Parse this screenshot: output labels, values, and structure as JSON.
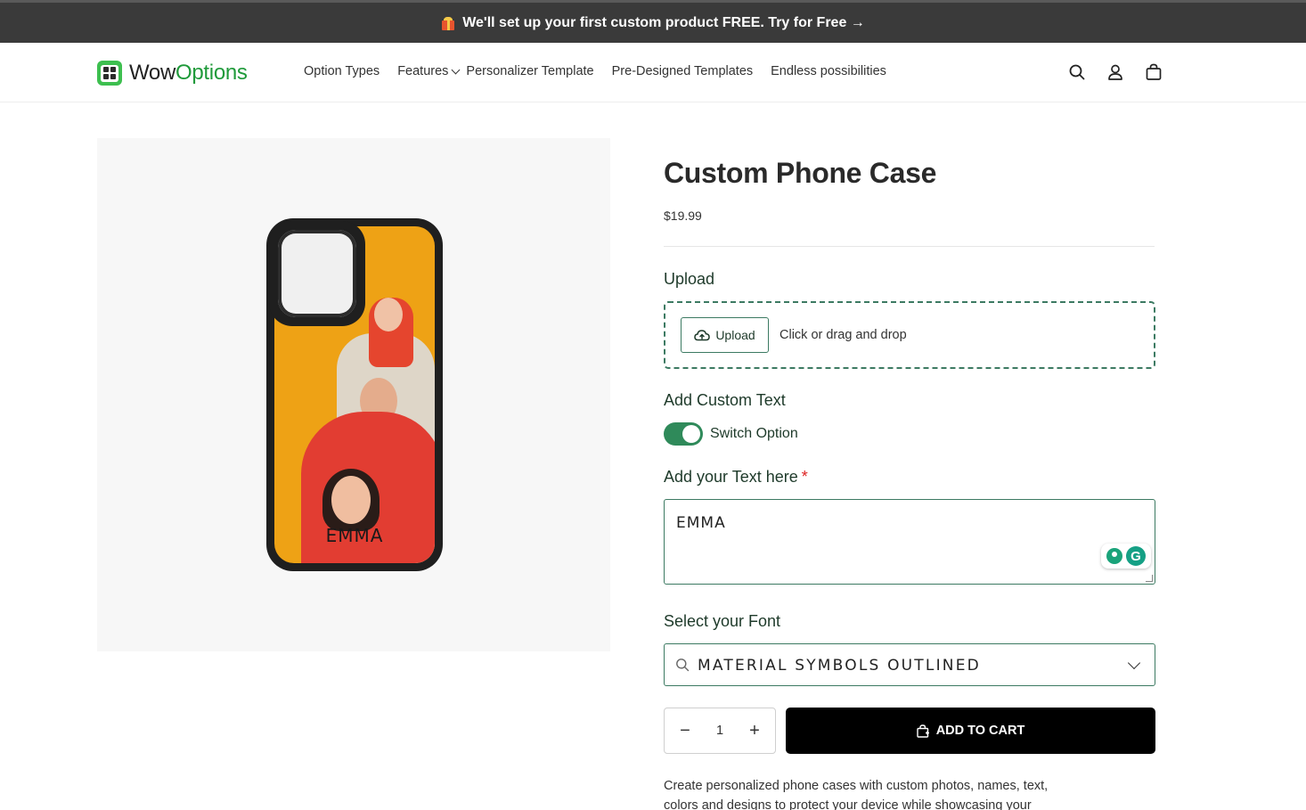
{
  "announcement": {
    "text": "We'll set up your first custom product FREE. Try for Free →"
  },
  "brand": {
    "name_part1": "Wow",
    "name_part2": "Options",
    "accent": "#1f9a3a"
  },
  "nav": {
    "items": [
      "Option Types",
      "Features",
      "Personalizer Template",
      "Pre-Designed Templates",
      "Endless possibilities"
    ]
  },
  "header_icons": [
    "search-icon",
    "account-icon",
    "cart-icon"
  ],
  "product": {
    "title": "Custom Phone Case",
    "price": "$19.99",
    "preview_text": "EMMA",
    "upload": {
      "label": "Upload",
      "button": "Upload",
      "hint": "Click or drag and drop"
    },
    "custom_text": {
      "label": "Add Custom Text",
      "switch_label": "Switch Option",
      "switch_on": true
    },
    "text_field": {
      "label": "Add your Text here",
      "required": "*",
      "value": "EMMA"
    },
    "font": {
      "label": "Select your Font",
      "value": "MATERIAL SYMBOLS OUTLINED"
    },
    "quantity": {
      "value": "1",
      "minus": "−",
      "plus": "+"
    },
    "add_to_cart": "ADD TO CART",
    "description": "Create personalized phone cases with custom photos, names, text, colors and designs to protect your device while showcasing your"
  },
  "colors": {
    "announcement_bg": "#3a3a3a",
    "primary_green": "#2f8a5a",
    "border_green": "#3c7a62",
    "cta_bg": "#000000"
  }
}
